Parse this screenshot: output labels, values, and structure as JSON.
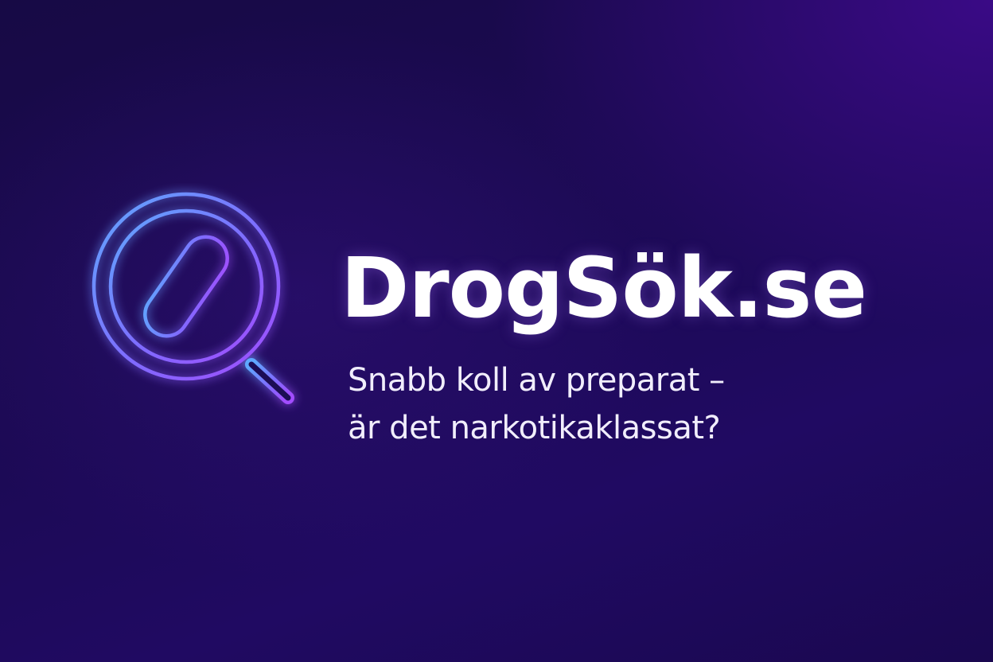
{
  "brand": {
    "name": "DrogSök.se",
    "logo_icon": "magnifier-pill-icon"
  },
  "tagline": {
    "line1": "Snabb koll av preparat –",
    "line2": "är det narkotikaklassat?"
  },
  "colors": {
    "background_dark": "#170a45",
    "background_accent": "#3a0a86",
    "icon_gradient_start": "#5fa8ff",
    "icon_gradient_end": "#a24dff",
    "text": "#ffffff"
  }
}
